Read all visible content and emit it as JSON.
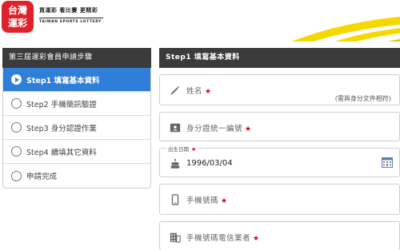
{
  "header": {
    "logo_line1": "台灣",
    "logo_line2": "運彩",
    "slogan": "買運彩 看比賽 更精彩",
    "brand_en": "TAIWAN SPORTS LOTTERY"
  },
  "steps_panel": {
    "title": "第三屆運彩會員申請步驟",
    "steps": [
      {
        "label": "Step1 填寫基本資料",
        "active": true
      },
      {
        "label": "Step2 手機簡訊驗證",
        "active": false
      },
      {
        "label": "Step3 身分認證作業",
        "active": false
      },
      {
        "label": "Step4 續填其它資料",
        "active": false
      },
      {
        "label": "申請完成",
        "active": false
      }
    ]
  },
  "form_panel": {
    "title": "Step1 填寫基本資料",
    "fields": {
      "name": {
        "label": "姓名",
        "required": "★",
        "note": "(需與身分文件相符)",
        "icon": "pencil-icon"
      },
      "id_number": {
        "label": "身分證統一編號",
        "required": "★",
        "icon": "id-card-icon"
      },
      "birthday": {
        "float_label": "出生日期",
        "required": "★",
        "value": "1996/03/04",
        "icon": "cake-icon"
      },
      "mobile": {
        "label": "手機號碼",
        "required": "★",
        "icon": "phone-icon"
      },
      "carrier": {
        "label": "手機號碼電信業者",
        "required": "★",
        "icon": "building-icon"
      }
    }
  },
  "colors": {
    "brand_red": "#e0202a",
    "active_blue": "#2f7fd8",
    "panel_header": "#3b3b3b",
    "required_red": "#d0021b",
    "swoosh_yellow": "#f5d800"
  }
}
